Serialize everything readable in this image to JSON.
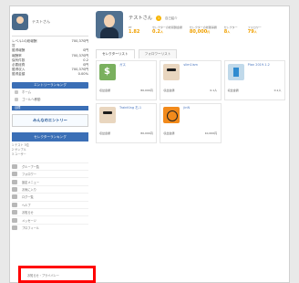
{
  "sidebar": {
    "profile_name": "テストさん",
    "stats": [
      {
        "label": "レベル1の総報酬",
        "value": "700,370円"
      },
      {
        "label": "賞",
        "value": ""
      },
      {
        "label": "獲得報酬",
        "value": "0円"
      },
      {
        "label": "報酬率",
        "value": "700,370円"
      },
      {
        "label": "保有件数",
        "value": "0.2"
      },
      {
        "label": "必要経費",
        "value": "0円"
      },
      {
        "label": "獲得収入",
        "value": "700,370円"
      },
      {
        "label": "獲得金額",
        "value": "0.00%"
      }
    ],
    "button_label": "エントリーランキング",
    "menu_items": [
      "ホーム",
      "ゴールへ移動"
    ],
    "bar_label": "目標",
    "banner_text": "みんなのエントリー",
    "ranking_title": "セレクターランキング",
    "ranking_lines": [
      "1 テスト 3位",
      "2 サンプル",
      "3 ユーザー"
    ],
    "list_items": [
      "グループ一覧",
      "フォロワー",
      "設定メニュー",
      "お気に入り",
      "ログ一覧",
      "ヘルプ",
      "お知らせ",
      "メッセージ",
      "プロフィール"
    ],
    "bottom_note": "お知らせ・プライバシー"
  },
  "header": {
    "username": "テストさん",
    "badge_number": "1",
    "link_text": "自己紹介"
  },
  "stats": [
    {
      "label": "PT",
      "value": "1.82",
      "unit": ""
    },
    {
      "label": "セレクターの総報酬金額",
      "value": "0.2",
      "unit": "人"
    },
    {
      "label": "セレクターの総獲得額",
      "value": "80,000",
      "unit": "円"
    },
    {
      "label": "セレクター",
      "value": "8",
      "unit": "人"
    },
    {
      "label": "フォロワー",
      "value": "79",
      "unit": "人"
    }
  ],
  "tabs": [
    "セレクターリスト",
    "フォロワーリスト"
  ],
  "cards": [
    {
      "name": "ガス",
      "pic": "money",
      "left_label": "収益金額",
      "left_value": "80,000円",
      "right_label": "",
      "right_value": ""
    },
    {
      "name": "slim1ism",
      "pic": "glasses",
      "left_label": "収益金額",
      "left_value": "",
      "right_label": "",
      "right_value": "0.1人"
    },
    {
      "name": "Plan 2019.1.2",
      "pic": "sign",
      "left_label": "収益金額",
      "left_value": "",
      "right_label": "",
      "right_value": "0.1人"
    },
    {
      "name": "TrainKing 右.1",
      "pic": "glasses",
      "left_label": "収益金額",
      "left_value": "",
      "right_label": "",
      "right_value": "80,000円"
    },
    {
      "name": "jinN",
      "pic": "tiger",
      "left_label": "収益金額",
      "left_value": "",
      "right_label": "",
      "right_value": "10,000円"
    }
  ],
  "colors": {
    "accent": "#3b6fb6",
    "highlight": "#ff0000",
    "orange": "#f0a000"
  }
}
